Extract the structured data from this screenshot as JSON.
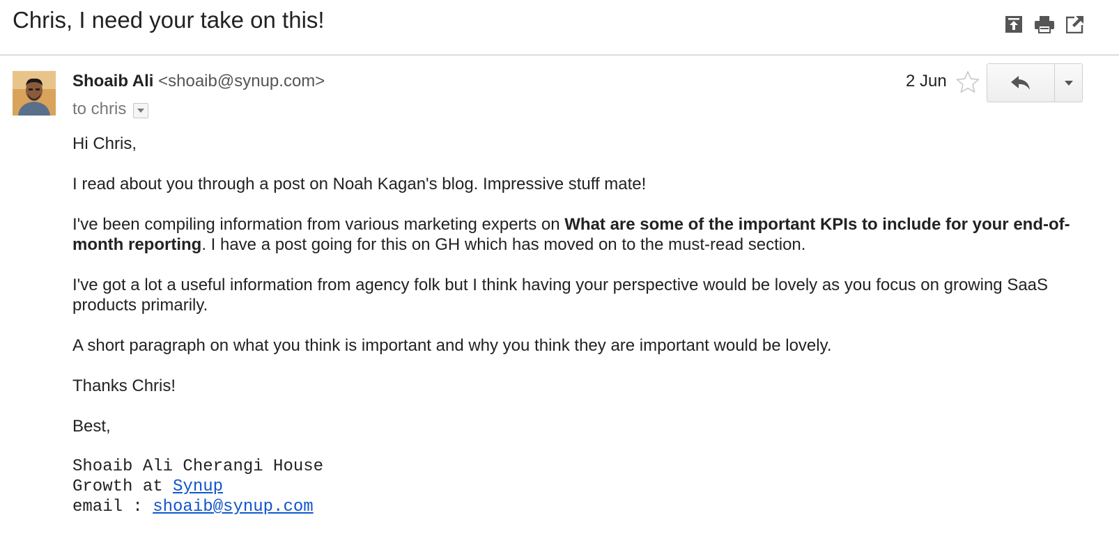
{
  "subject": "Chris, I need your take on this!",
  "toolbar": {
    "archive_icon": "move-to-top-icon",
    "print_icon": "print-icon",
    "popout_icon": "new-window-icon"
  },
  "message": {
    "sender_name": "Shoaib Ali",
    "sender_email": "<shoaib@synup.com>",
    "to_text": "to chris",
    "date": "2 Jun"
  },
  "body": {
    "greeting": "Hi Chris,",
    "p1": "I read about you through a post on Noah Kagan's blog. Impressive stuff mate!",
    "p2_before": "I've been compiling information from various marketing experts on ",
    "p2_bold": "What are some of the important KPIs to include for your end-of-month reporting",
    "p2_after": ". I have a post going for this on GH which has moved on to the must-read section.",
    "p3": "I've got a lot a useful information from agency folk but I think having your perspective would be lovely as you focus on growing SaaS products primarily.",
    "p4": "A short paragraph on what you think is important and why you think they are important would be lovely.",
    "thanks": "Thanks Chris!",
    "closing": "Best,"
  },
  "signature": {
    "line1": "Shoaib Ali Cherangi House",
    "line2_prefix": "Growth at ",
    "line2_link": "Synup",
    "line3_prefix": "email : ",
    "line3_link": "shoaib@synup.com"
  },
  "colors": {
    "link": "#1155cc",
    "divider": "#dcdcdc",
    "muted": "#777777"
  }
}
